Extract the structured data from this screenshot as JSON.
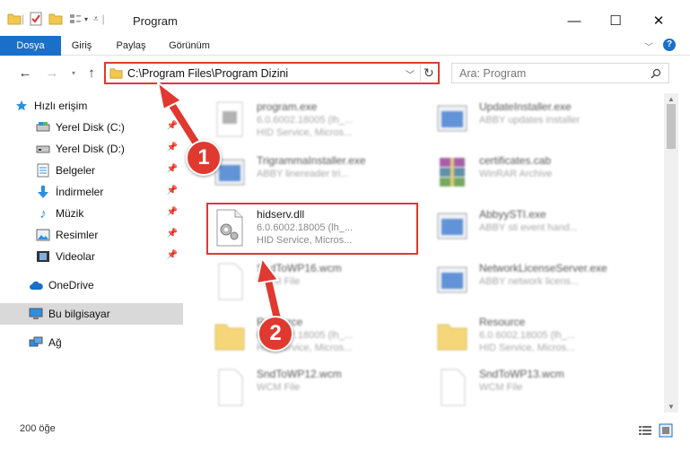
{
  "window": {
    "title": "Program",
    "minimize": "—",
    "maximize": "☐",
    "close": "✕"
  },
  "ribbon": {
    "tabs": [
      "Dosya",
      "Giriş",
      "Paylaş",
      "Görünüm"
    ],
    "help": "?"
  },
  "address": {
    "path": "C:\\Program Files\\Program Dizini",
    "search_placeholder": "Ara: Program"
  },
  "sidebar": {
    "items": [
      {
        "label": "Hızlı erişim",
        "icon": "star-icon"
      },
      {
        "label": "Yerel Disk (C:)",
        "icon": "drive-icon",
        "pinned": true
      },
      {
        "label": "Yerel Disk (D:)",
        "icon": "drive-icon",
        "pinned": true
      },
      {
        "label": "Belgeler",
        "icon": "documents-icon",
        "pinned": true
      },
      {
        "label": "İndirmeler",
        "icon": "download-icon",
        "pinned": true
      },
      {
        "label": "Müzik",
        "icon": "music-icon",
        "pinned": true
      },
      {
        "label": "Resimler",
        "icon": "pictures-icon",
        "pinned": true
      },
      {
        "label": "Videolar",
        "icon": "video-icon",
        "pinned": true
      },
      {
        "label": "OneDrive",
        "icon": "cloud-icon"
      },
      {
        "label": "Bu bilgisayar",
        "icon": "computer-icon",
        "selected": true
      },
      {
        "label": "Ağ",
        "icon": "network-icon"
      }
    ]
  },
  "files": [
    {
      "name": "program.exe",
      "line1": "6.0.6002.18005 (lh_...",
      "line2": "HID Service, Micros...",
      "kind": "exe"
    },
    {
      "name": "UpdateInstaller.exe",
      "line1": "ABBY updates installer",
      "line2": "",
      "kind": "app"
    },
    {
      "name": "TrigrammaInstaller.exe",
      "line1": "ABBY linereader tri...",
      "line2": "",
      "kind": "app"
    },
    {
      "name": "certificates.cab",
      "line1": "WinRAR Archive",
      "line2": "",
      "kind": "rar"
    },
    {
      "name": "hidserv.dll",
      "line1": "6.0.6002.18005 (lh_...",
      "line2": "HID Service, Micros...",
      "kind": "dll",
      "highlighted": true
    },
    {
      "name": "AbbyySTI.exe",
      "line1": "ABBY sti event hand...",
      "line2": "",
      "kind": "app"
    },
    {
      "name": "SndToWP16.wcm",
      "line1": "WCM File",
      "line2": "",
      "kind": "blank"
    },
    {
      "name": "NetworkLicenseServer.exe",
      "line1": "ABBY network licens...",
      "line2": "",
      "kind": "app"
    },
    {
      "name": "Resource",
      "line1": "6.0.6002.18005 (lh_...",
      "line2": "HID Service, Micros...",
      "kind": "folder"
    },
    {
      "name": "Resource",
      "line1": "6.0.6002.18005 (lh_...",
      "line2": "HID Service, Micros...",
      "kind": "folder"
    },
    {
      "name": "SndToWP12.wcm",
      "line1": "WCM File",
      "line2": "",
      "kind": "blank"
    },
    {
      "name": "SndToWP13.wcm",
      "line1": "WCM File",
      "line2": "",
      "kind": "blank"
    }
  ],
  "status": {
    "count": "200 öğe"
  },
  "callouts": [
    "1",
    "2"
  ],
  "colors": {
    "accent": "#1a6fc9",
    "highlight": "#e0392f"
  }
}
